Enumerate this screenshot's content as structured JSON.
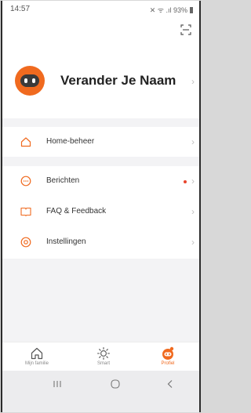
{
  "status_bar": {
    "time": "14:57",
    "indicators": "✕ ᯤ .ıl 93%"
  },
  "profile": {
    "name": "Verander Je Naam"
  },
  "menu": {
    "home_management": "Home-beheer",
    "messages": "Berichten",
    "faq": "FAQ & Feedback",
    "settings": "Instellingen"
  },
  "tabs": {
    "home": "Mijn familie",
    "smart": "Smart",
    "me": "Profiel"
  },
  "icons": {
    "scan": "scan-icon",
    "home": "house-icon",
    "messages": "chat-bubble-icon",
    "faq": "book-icon",
    "settings": "settings-icon"
  },
  "colors": {
    "accent": "#f06a1f",
    "notification_dot": "#e8452d"
  }
}
